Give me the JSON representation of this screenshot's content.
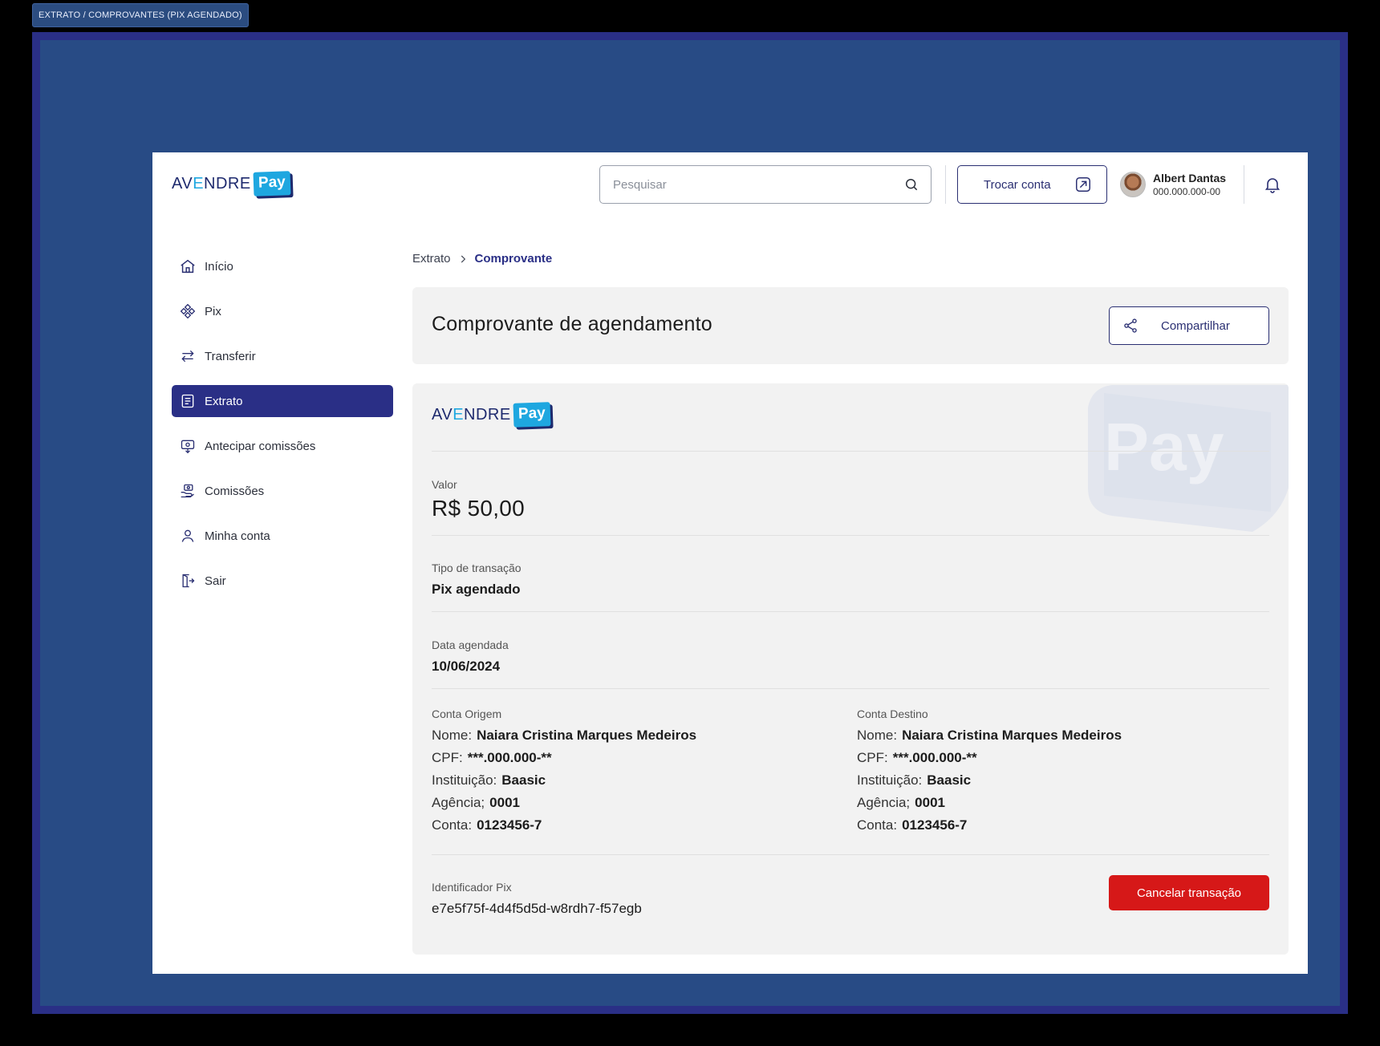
{
  "frame_label": "EXTRATO / COMPROVANTES (PIX AGENDADO)",
  "brand": {
    "word_a": "AV",
    "word_e": "E",
    "word_b": "NDRE",
    "pay": "Pay",
    "watermark_text": "Pay"
  },
  "header": {
    "search_placeholder": "Pesquisar",
    "switch_account_label": "Trocar conta",
    "user": {
      "name": "Albert Dantas",
      "document": "000.000.000-00"
    }
  },
  "sidebar": {
    "items": [
      {
        "label": "Início",
        "icon": "home-icon"
      },
      {
        "label": "Pix",
        "icon": "pix-icon"
      },
      {
        "label": "Transferir",
        "icon": "transfer-icon"
      },
      {
        "label": "Extrato",
        "icon": "statement-icon",
        "active": true
      },
      {
        "label": "Antecipar comissões",
        "icon": "advance-commission-icon"
      },
      {
        "label": "Comissões",
        "icon": "commission-icon"
      },
      {
        "label": "Minha conta",
        "icon": "user-icon"
      },
      {
        "label": "Sair",
        "icon": "logout-icon"
      }
    ]
  },
  "breadcrumb": {
    "prev": "Extrato",
    "current": "Comprovante"
  },
  "receipt": {
    "title": "Comprovante de agendamento",
    "share_label": "Compartilhar",
    "value_label": "Valor",
    "value": "R$ 50,00",
    "type_label": "Tipo de transação",
    "type": "Pix agendado",
    "date_label": "Data agendada",
    "date": "10/06/2024",
    "origin": {
      "label": "Conta Origem",
      "rows": [
        {
          "k": "Nome:",
          "v": "Naiara Cristina Marques Medeiros"
        },
        {
          "k": "CPF:",
          "v": "***.000.000-**"
        },
        {
          "k": "Instituição:",
          "v": "Baasic"
        },
        {
          "k": "Agência;",
          "v": "0001"
        },
        {
          "k": "Conta:",
          "v": "0123456-7"
        }
      ]
    },
    "destination": {
      "label": "Conta Destino",
      "rows": [
        {
          "k": "Nome:",
          "v": "Naiara Cristina Marques Medeiros"
        },
        {
          "k": "CPF:",
          "v": "***.000.000-**"
        },
        {
          "k": "Instituição:",
          "v": "Baasic"
        },
        {
          "k": "Agência;",
          "v": "0001"
        },
        {
          "k": "Conta:",
          "v": "0123456-7"
        }
      ]
    },
    "pix_id_label": "Identificador Pix",
    "pix_id": "e7e5f75f-4d4f5d5d-w8rdh7-f57egb",
    "cancel_label": "Cancelar transação"
  },
  "colors": {
    "primary": "#2a2f86",
    "accent": "#1ea7e0",
    "danger": "#d61818",
    "background": "#284b85"
  }
}
